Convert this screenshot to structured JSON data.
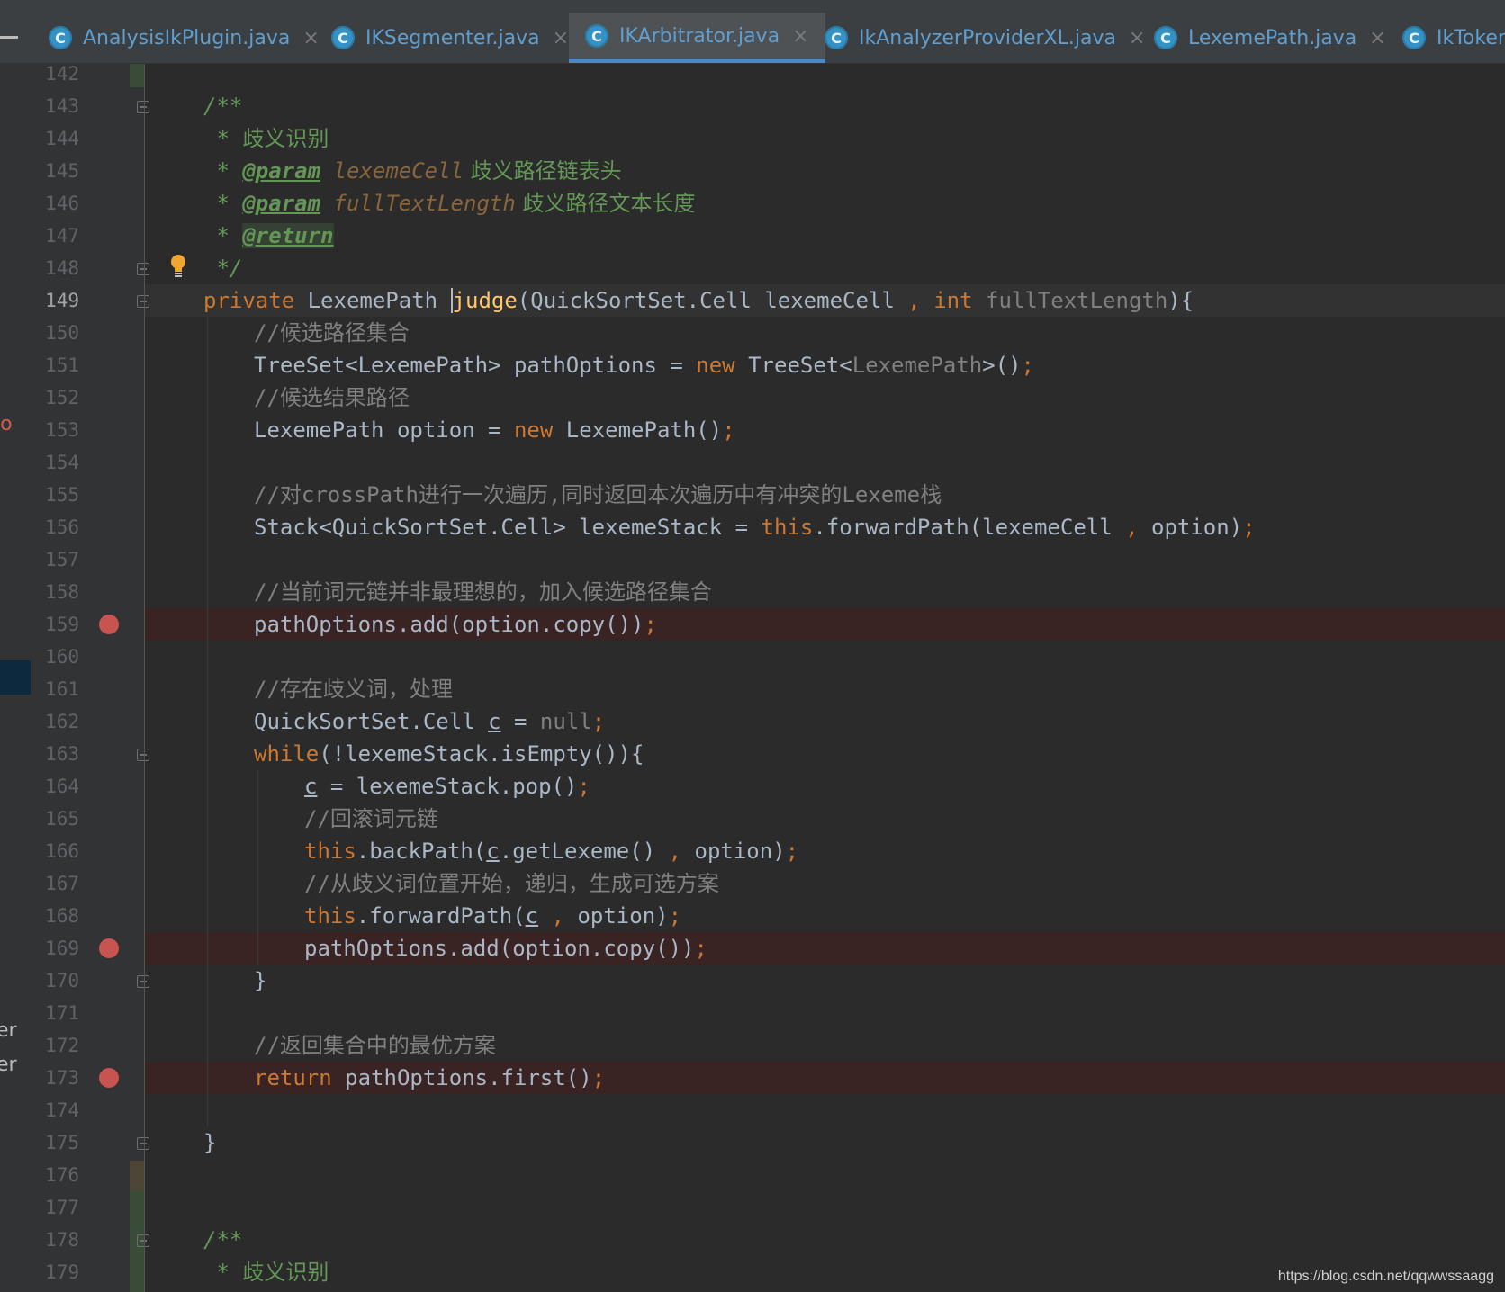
{
  "tabs": [
    {
      "label": "AnalysisIkPlugin.java",
      "active": false
    },
    {
      "label": "IKSegmenter.java",
      "active": false
    },
    {
      "label": "IKArbitrator.java",
      "active": true
    },
    {
      "label": "IkAnalyzerProviderXL.java",
      "active": false
    },
    {
      "label": "LexemePath.java",
      "active": false
    },
    {
      "label": "IkToker",
      "active": false
    }
  ],
  "tab_icon_letter": "C",
  "close_glyph": "×",
  "left_strip": {
    "items": [
      "io",
      "er",
      "er"
    ]
  },
  "current_line": 149,
  "breakpoint_lines": [
    159,
    169,
    173
  ],
  "code": {
    "l142": "142",
    "l143": "143",
    "c143": "/**",
    "l144": "144",
    "c144a": " * ",
    "c144b": "歧义识别",
    "l145": "145",
    "c145a": " * ",
    "c145tag": "@param",
    "c145p": "lexemeCell",
    "c145d": " 歧义路径链表头",
    "l146": "146",
    "c146a": " * ",
    "c146tag": "@param",
    "c146p": "fullTextLength",
    "c146d": " 歧义路径文本长度",
    "l147": "147",
    "c147a": " * ",
    "c147tag": "@return",
    "l148": "148",
    "c148": " */",
    "l149": "149",
    "c149_kw1": "private",
    "c149_t1": " LexemePath ",
    "c149_fn": "judge",
    "c149_t2": "(QuickSortSet.Cell lexemeCell ",
    "c149_comma": ",",
    "c149_kw2": "int",
    "c149_p2": "fullTextLength",
    "c149_t3": "){",
    "l150": "150",
    "c150": "//候选路径集合",
    "l151": "151",
    "c151a": "TreeSet<LexemePath> pathOptions = ",
    "c151kw": "new",
    "c151b": " TreeSet<",
    "c151gen": "LexemePath",
    "c151c": ">()",
    "c151semi": ";",
    "l152": "152",
    "c152": "//候选结果路径",
    "l153": "153",
    "c153a": "LexemePath option = ",
    "c153kw": "new",
    "c153b": " LexemePath()",
    "c153semi": ";",
    "l154": "154",
    "l155": "155",
    "c155": "//对crossPath进行一次遍历,同时返回本次遍历中有冲突的Lexeme栈",
    "l156": "156",
    "c156a": "Stack<QuickSortSet.Cell> lexemeStack = ",
    "c156kw": "this",
    "c156b": ".forwardPath(lexemeCell ",
    "c156comma": ",",
    "c156c": " option)",
    "c156semi": ";",
    "l157": "157",
    "l158": "158",
    "c158": "//当前词元链并非最理想的，加入候选路径集合",
    "l159": "159",
    "c159": "pathOptions.add(option.copy())",
    "c159semi": ";",
    "l160": "160",
    "l161": "161",
    "c161": "//存在歧义词，处理",
    "l162": "162",
    "c162a": "QuickSortSet.Cell ",
    "c162var": "c",
    "c162b": " = ",
    "c162null": "null",
    "c162semi": ";",
    "l163": "163",
    "c163kw": "while",
    "c163a": "(!lexemeStack.isEmpty()){",
    "l164": "164",
    "c164var": "c",
    "c164a": " = lexemeStack.pop()",
    "c164semi": ";",
    "l165": "165",
    "c165": "//回滚词元链",
    "l166": "166",
    "c166kw": "this",
    "c166a": ".backPath(",
    "c166var": "c",
    "c166b": ".getLexeme() ",
    "c166comma": ",",
    "c166c": " option)",
    "c166semi": ";",
    "l167": "167",
    "c167": "//从歧义词位置开始，递归，生成可选方案",
    "l168": "168",
    "c168kw": "this",
    "c168a": ".forwardPath(",
    "c168var": "c",
    "c168b": " ",
    "c168comma": ",",
    "c168c": " option)",
    "c168semi": ";",
    "l169": "169",
    "c169": "pathOptions.add(option.copy())",
    "c169semi": ";",
    "l170": "170",
    "c170": "}",
    "l171": "171",
    "l172": "172",
    "c172": "//返回集合中的最优方案",
    "l173": "173",
    "c173kw": "return",
    "c173a": " pathOptions.first()",
    "c173semi": ";",
    "l174": "174",
    "l175": "175",
    "c175": "}",
    "l176": "176",
    "l177": "177",
    "l178": "178",
    "c178": "/**",
    "l179": "179",
    "c179a": " * ",
    "c179b": "歧义识别"
  },
  "watermark": "https://blog.csdn.net/qqwwssaagg",
  "colors": {
    "background": "#2b2b2b",
    "keyword": "#cc7832",
    "comment": "#808080",
    "doc_comment": "#629755",
    "method": "#ffc66d",
    "breakpoint": "#c75450",
    "active_tab_underline": "#4a88c7"
  }
}
